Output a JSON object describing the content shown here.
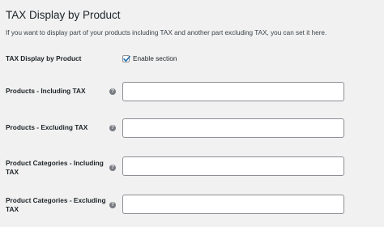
{
  "section": {
    "title": "TAX Display by Product",
    "description": "If you want to display part of your products including TAX and another part excluding TAX, you can set it here."
  },
  "rows": [
    {
      "label": "TAX Display by Product",
      "checkbox_label": "Enable section",
      "checked": true
    },
    {
      "label": "Products - Including TAX",
      "help_glyph": "?",
      "value": ""
    },
    {
      "label": "Products - Excluding TAX",
      "help_glyph": "?",
      "value": ""
    },
    {
      "label": "Product Categories - Including TAX",
      "help_glyph": "?",
      "value": ""
    },
    {
      "label": "Product Categories - Excluding TAX",
      "help_glyph": "?",
      "value": ""
    }
  ],
  "colors": {
    "background": "#f1f1f1",
    "checkmark": "#2271b1",
    "input_border": "#8c8f94",
    "help_icon": "#787c82"
  },
  "icons": {
    "help": "help-tip-icon",
    "check": "checkmark-icon"
  }
}
